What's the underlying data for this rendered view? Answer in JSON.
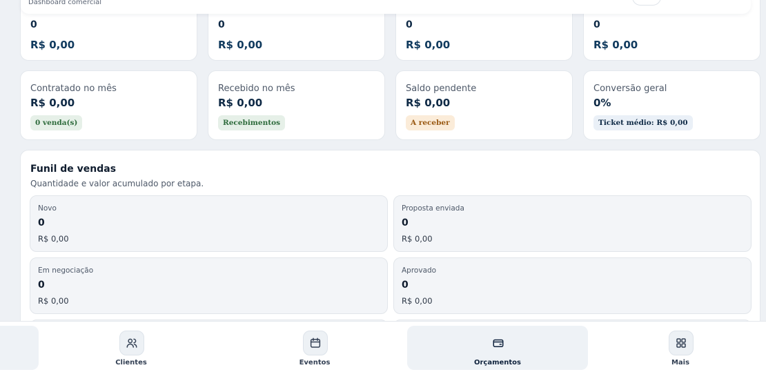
{
  "header": {
    "subtitle": "Dashboard comercial"
  },
  "top_cards": [
    {
      "count": "0",
      "amount": "R$ 0,00"
    },
    {
      "count": "0",
      "amount": "R$ 0,00"
    },
    {
      "count": "0",
      "amount": "R$ 0,00"
    },
    {
      "count": "0",
      "amount": "R$ 0,00"
    }
  ],
  "stat_cards": [
    {
      "label": "Contratado no mês",
      "value": "R$ 0,00",
      "pill": "0 venda(s)"
    },
    {
      "label": "Recebido no mês",
      "value": "R$ 0,00",
      "pill": "Recebimentos"
    },
    {
      "label": "Saldo pendente",
      "value": "R$ 0,00",
      "pill": "A receber"
    },
    {
      "label": "Conversão geral",
      "value": "0%",
      "pill": "Ticket médio: R$ 0,00"
    }
  ],
  "funnel": {
    "title": "Funil de vendas",
    "description": "Quantidade e valor acumulado por etapa.",
    "stages": [
      {
        "name": "Novo",
        "count": "0",
        "amount": "R$ 0,00"
      },
      {
        "name": "Proposta enviada",
        "count": "0",
        "amount": "R$ 0,00"
      },
      {
        "name": "Em negociação",
        "count": "0",
        "amount": "R$ 0,00"
      },
      {
        "name": "Aprovado",
        "count": "0",
        "amount": "R$ 0,00"
      }
    ]
  },
  "bottom_nav": {
    "items": [
      {
        "label": "Clientes",
        "icon": "users-icon"
      },
      {
        "label": "Eventos",
        "icon": "calendar-icon"
      },
      {
        "label": "Orçamentos",
        "icon": "wallet-icon",
        "active": true
      },
      {
        "label": "Mais",
        "icon": "grid-icon"
      }
    ]
  },
  "colors": {
    "background": "#eef1f5",
    "card": "#ffffff",
    "accent": "#103a5e",
    "pill_green": "#e6f0e8",
    "pill_amber": "#fbecd9",
    "pill_blue": "#eaf0f7"
  }
}
